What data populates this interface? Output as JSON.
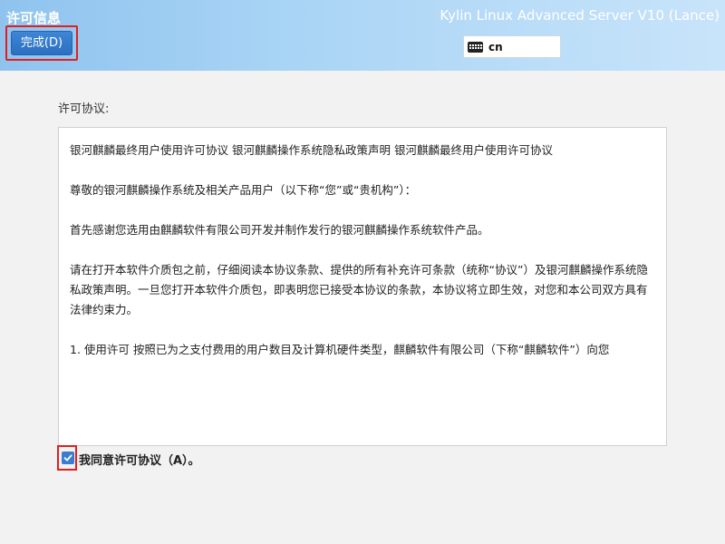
{
  "header": {
    "title": "许可信息",
    "done_label": "完成(D)",
    "product": "Kylin Linux Advanced Server V10 (Lance)",
    "keyboard_layout": "cn"
  },
  "license": {
    "label": "许可协议:",
    "paragraphs": [
      "银河麒麟最终用户使用许可协议 银河麒麟操作系统隐私政策声明 银河麒麟最终用户使用许可协议",
      " 尊敬的银河麒麟操作系统及相关产品用户（以下称“您”或“贵机构”）：",
      " 首先感谢您选用由麒麟软件有限公司开发并制作发行的银河麒麟操作系统软件产品。",
      " 请在打开本软件介质包之前，仔细阅读本协议条款、提供的所有补充许可条款（统称“协议”）及银河麒麟操作系统隐私政策声明。一旦您打开本软件介质包，即表明您已接受本协议的条款，本协议将立即生效，对您和本公司双方具有法律约束力。",
      " 1. 使用许可 按照已为之支付费用的用户数目及计算机硬件类型，麒麟软件有限公司（下称“麒麟软件”）向您"
    ]
  },
  "agree": {
    "label": "我同意许可协议（A）。",
    "checked": true
  },
  "colors": {
    "accent": "#2b6fc0",
    "highlight": "#e02020"
  }
}
